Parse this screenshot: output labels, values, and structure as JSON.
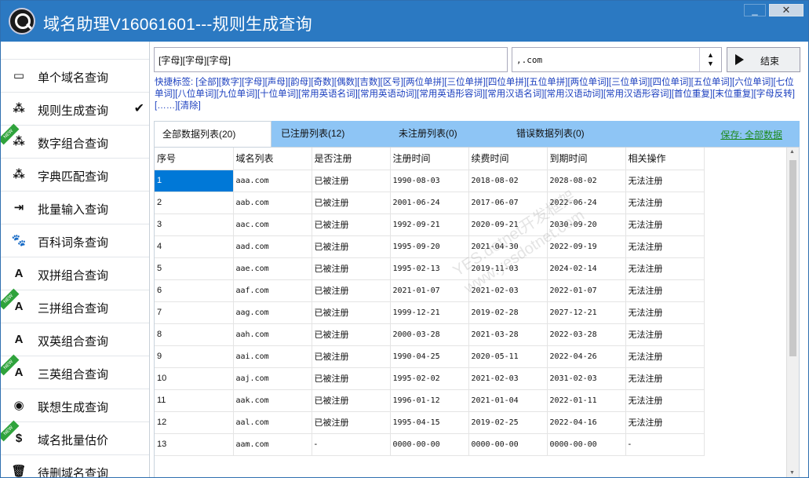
{
  "window": {
    "title": "域名助理V16061601---规则生成查询",
    "minimize": "_",
    "close": "✕"
  },
  "sidebar": {
    "items": [
      {
        "label": "单个域名查询",
        "icon": "terminal-icon",
        "glyph": "▭",
        "new": false,
        "checked": false
      },
      {
        "label": "规则生成查询",
        "icon": "nodes-icon",
        "glyph": "⁂",
        "new": false,
        "checked": true
      },
      {
        "label": "数字组合查询",
        "icon": "nodes-icon",
        "glyph": "⁂",
        "new": true,
        "checked": false
      },
      {
        "label": "字典匹配查询",
        "icon": "nodes-icon",
        "glyph": "⁂",
        "new": false,
        "checked": false
      },
      {
        "label": "批量输入查询",
        "icon": "indent-icon",
        "glyph": "⇥",
        "new": false,
        "checked": false
      },
      {
        "label": "百科词条查询",
        "icon": "paw-icon",
        "glyph": "🐾",
        "new": false,
        "checked": false
      },
      {
        "label": "双拼组合查询",
        "icon": "font-a-icon",
        "glyph": "A",
        "new": false,
        "checked": false
      },
      {
        "label": "三拼组合查询",
        "icon": "font-a-icon",
        "glyph": "A",
        "new": true,
        "checked": false
      },
      {
        "label": "双英组合查询",
        "icon": "letter-box-icon",
        "glyph": "A",
        "new": false,
        "checked": false
      },
      {
        "label": "三英组合查询",
        "icon": "letter-box-icon",
        "glyph": "A",
        "new": true,
        "checked": false
      },
      {
        "label": "联想生成查询",
        "icon": "podcast-icon",
        "glyph": "◉",
        "new": false,
        "checked": false
      },
      {
        "label": "域名批量估价",
        "icon": "money-icon",
        "glyph": "$",
        "new": true,
        "checked": false
      },
      {
        "label": "待删域名查询",
        "icon": "trash-icon",
        "glyph": "🗑",
        "new": false,
        "checked": false
      }
    ],
    "check_glyph": "✔",
    "new_label": "NEW"
  },
  "query": {
    "input_value": "[字母][字母][字母]",
    "suffix_value": ",.com",
    "stop_label": "结束"
  },
  "tags": {
    "lead": "快捷标签:",
    "items": [
      "[全部]",
      "[数字]",
      "[字母]",
      "[声母]",
      "[韵母]",
      "[奇数]",
      "[偶数]",
      "[吉数]",
      "[区号]",
      "[两位单拼]",
      "[三位单拼]",
      "[四位单拼]",
      "[五位单拼]",
      "[两位单词]",
      "[三位单词]",
      "[四位单词]",
      "[五位单词]",
      "[六位单词]",
      "[七位单词]",
      "[八位单词]",
      "[九位单词]",
      "[十位单词]",
      "[常用英语名词]",
      "[常用英语动词]",
      "[常用英语形容词]",
      "[常用汉语名词]",
      "[常用汉语动词]",
      "[常用汉语形容词]",
      "[首位重复]",
      "[末位重复]",
      "[字母反转]",
      "[……]",
      "[清除]"
    ]
  },
  "tabs": [
    {
      "label": "全部数据列表(20)",
      "active": true
    },
    {
      "label": "已注册列表(12)",
      "active": false
    },
    {
      "label": "未注册列表(0)",
      "active": false
    },
    {
      "label": "错误数据列表(0)",
      "active": false
    }
  ],
  "save_label": "保存: 全部数据",
  "table": {
    "columns": [
      "序号",
      "域名列表",
      "是否注册",
      "注册时间",
      "续费时间",
      "到期时间",
      "相关操作"
    ],
    "rows": [
      [
        "1",
        "aaa.com",
        "已被注册",
        "1990-08-03",
        "2018-08-02",
        "2028-08-02",
        "无法注册"
      ],
      [
        "2",
        "aab.com",
        "已被注册",
        "2001-06-24",
        "2017-06-07",
        "2022-06-24",
        "无法注册"
      ],
      [
        "3",
        "aac.com",
        "已被注册",
        "1992-09-21",
        "2020-09-21",
        "2030-09-20",
        "无法注册"
      ],
      [
        "4",
        "aad.com",
        "已被注册",
        "1995-09-20",
        "2021-04-30",
        "2022-09-19",
        "无法注册"
      ],
      [
        "5",
        "aae.com",
        "已被注册",
        "1995-02-13",
        "2019-11-03",
        "2024-02-14",
        "无法注册"
      ],
      [
        "6",
        "aaf.com",
        "已被注册",
        "2021-01-07",
        "2021-02-03",
        "2022-01-07",
        "无法注册"
      ],
      [
        "7",
        "aag.com",
        "已被注册",
        "1999-12-21",
        "2019-02-28",
        "2027-12-21",
        "无法注册"
      ],
      [
        "8",
        "aah.com",
        "已被注册",
        "2000-03-28",
        "2021-03-28",
        "2022-03-28",
        "无法注册"
      ],
      [
        "9",
        "aai.com",
        "已被注册",
        "1990-04-25",
        "2020-05-11",
        "2022-04-26",
        "无法注册"
      ],
      [
        "10",
        "aaj.com",
        "已被注册",
        "1995-02-02",
        "2021-02-03",
        "2031-02-03",
        "无法注册"
      ],
      [
        "11",
        "aak.com",
        "已被注册",
        "1996-01-12",
        "2021-01-04",
        "2022-01-11",
        "无法注册"
      ],
      [
        "12",
        "aal.com",
        "已被注册",
        "1995-04-15",
        "2019-02-25",
        "2022-04-16",
        "无法注册"
      ],
      [
        "13",
        "aam.com",
        "-",
        "0000-00-00",
        "0000-00-00",
        "0000-00-00",
        "-"
      ]
    ]
  },
  "watermark": {
    "line1": "YES.dotnet开发框架",
    "line2": "www.yesdotnet.com"
  }
}
